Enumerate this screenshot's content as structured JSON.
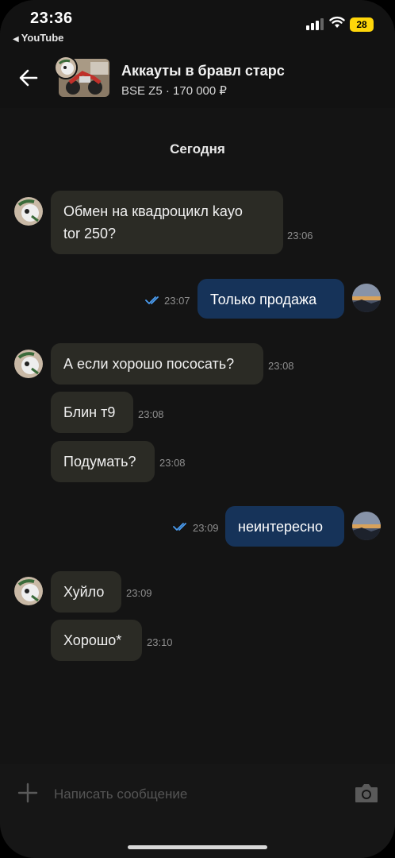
{
  "status_bar": {
    "time": "23:36",
    "back_app": "YouTube",
    "battery": "28"
  },
  "header": {
    "title": "Аккауты в бравл старс",
    "subtitle": "BSE Z5 · 170 000 ₽"
  },
  "day_separator": "Сегодня",
  "messages": [
    {
      "direction": "in",
      "text_line1": "Обмен на квадроцикл kayo",
      "text_line2": "tor 250?",
      "time": "23:06"
    },
    {
      "direction": "out",
      "text": "Только продажа",
      "time": "23:07",
      "read": true
    },
    {
      "direction": "in",
      "text": "А если хорошо пососать?",
      "time": "23:08"
    },
    {
      "direction": "in",
      "text": "Блин т9",
      "time": "23:08"
    },
    {
      "direction": "in",
      "text": "Подумать?",
      "time": "23:08"
    },
    {
      "direction": "out",
      "text": "неинтересно",
      "time": "23:09",
      "read": true
    },
    {
      "direction": "in",
      "text": "Хуйло",
      "time": "23:09"
    },
    {
      "direction": "in",
      "text": "Хорошо*",
      "time": "23:10"
    }
  ],
  "composer": {
    "placeholder": "Написать сообщение"
  },
  "colors": {
    "incoming_bubble": "#2b2b25",
    "outgoing_bubble": "#163359",
    "read_check": "#4a9cf0",
    "battery": "#ffd60a"
  },
  "icons": [
    "back-arrow-icon",
    "signal-icon",
    "wifi-icon",
    "battery-icon",
    "read-check-icon",
    "plus-icon",
    "camera-icon"
  ]
}
